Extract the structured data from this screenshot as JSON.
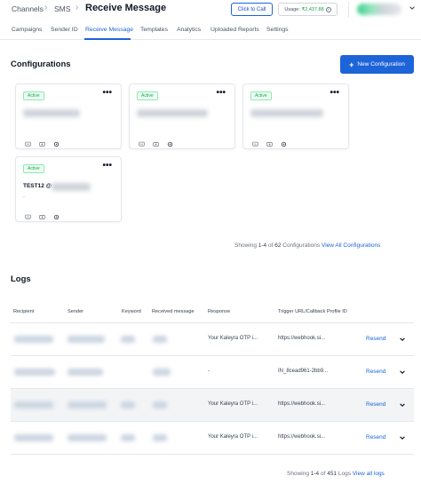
{
  "header": {
    "breadcrumb": [
      "Channels",
      "SMS"
    ],
    "title": "Receive Message",
    "click_to_call": "Click to Call",
    "usage_label": "Usage:",
    "usage_amount": "₹2,437.88"
  },
  "tabs": [
    {
      "label": "Campaigns"
    },
    {
      "label": "Sender ID"
    },
    {
      "label": "Receive Message",
      "active": true
    },
    {
      "label": "Templates"
    },
    {
      "label": "Analytics"
    },
    {
      "label": "Uploaded Reports"
    },
    {
      "label": "Settings"
    }
  ],
  "configurations": {
    "title": "Configurations",
    "new_button": "New Configuration",
    "cards": [
      {
        "status": "Active",
        "name": ""
      },
      {
        "status": "Active",
        "name": ""
      },
      {
        "status": "Active",
        "name": ""
      },
      {
        "status": "Active",
        "name": "TEST12 @"
      }
    ],
    "pager": {
      "prefix": "Showing",
      "range": "1-4",
      "of": "of",
      "total": "62",
      "noun": "Configurations",
      "link": "View All Configurations"
    }
  },
  "logs": {
    "title": "Logs",
    "columns": [
      "Recipient",
      "Sender",
      "Keyword",
      "Received message",
      "Response",
      "Trigger URL/Callback Profile ID"
    ],
    "rows": [
      {
        "response": "Your Kaleyra OTP i...",
        "trigger": "https://webhook.si...",
        "action": "Resend"
      },
      {
        "response": "-",
        "trigger": "IN_8cead961-2bb9...",
        "action": "Resend"
      },
      {
        "response": "Your Kaleyra OTP i...",
        "trigger": "https://webhook.si...",
        "action": "Resend"
      },
      {
        "response": "Your Kaleyra OTP i...",
        "trigger": "https://webhook.si...",
        "action": "Resend"
      }
    ],
    "pager": {
      "prefix": "Showing",
      "range": "1-4",
      "of": "of",
      "total": "451",
      "noun": "Logs",
      "link": "View all logs"
    }
  },
  "colors": {
    "accent": "#1d64d8",
    "active_badge": "#16a34a",
    "usage": "#16a34a"
  }
}
